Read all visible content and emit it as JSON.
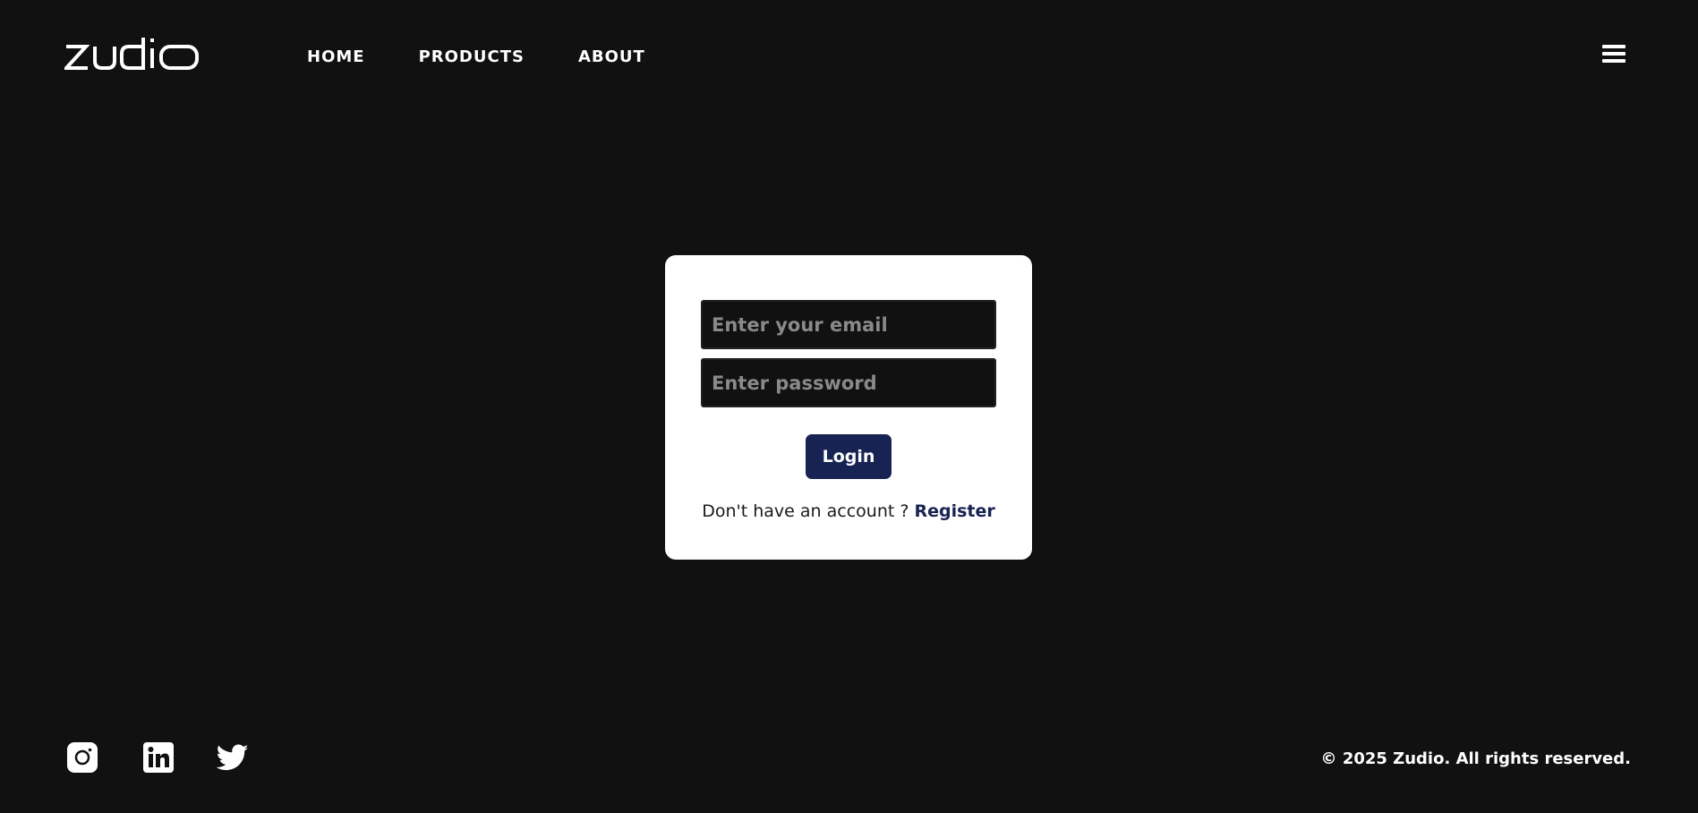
{
  "brand": {
    "logo_text": "zudio"
  },
  "nav": {
    "items": [
      {
        "label": "HOME"
      },
      {
        "label": "PRODUCTS"
      },
      {
        "label": "ABOUT"
      }
    ],
    "menu_icon": "hamburger-menu-icon"
  },
  "login": {
    "email_placeholder": "Enter your email",
    "email_value": "",
    "password_placeholder": "Enter password",
    "password_value": "",
    "login_label": "Login",
    "register_prompt": "Don't have an account ?",
    "register_label": "Register",
    "accent_color": "#172353"
  },
  "footer": {
    "social_icons": [
      "instagram-icon",
      "linkedin-icon",
      "twitter-icon"
    ],
    "copyright": "© 2025 Zudio. All rights reserved."
  }
}
